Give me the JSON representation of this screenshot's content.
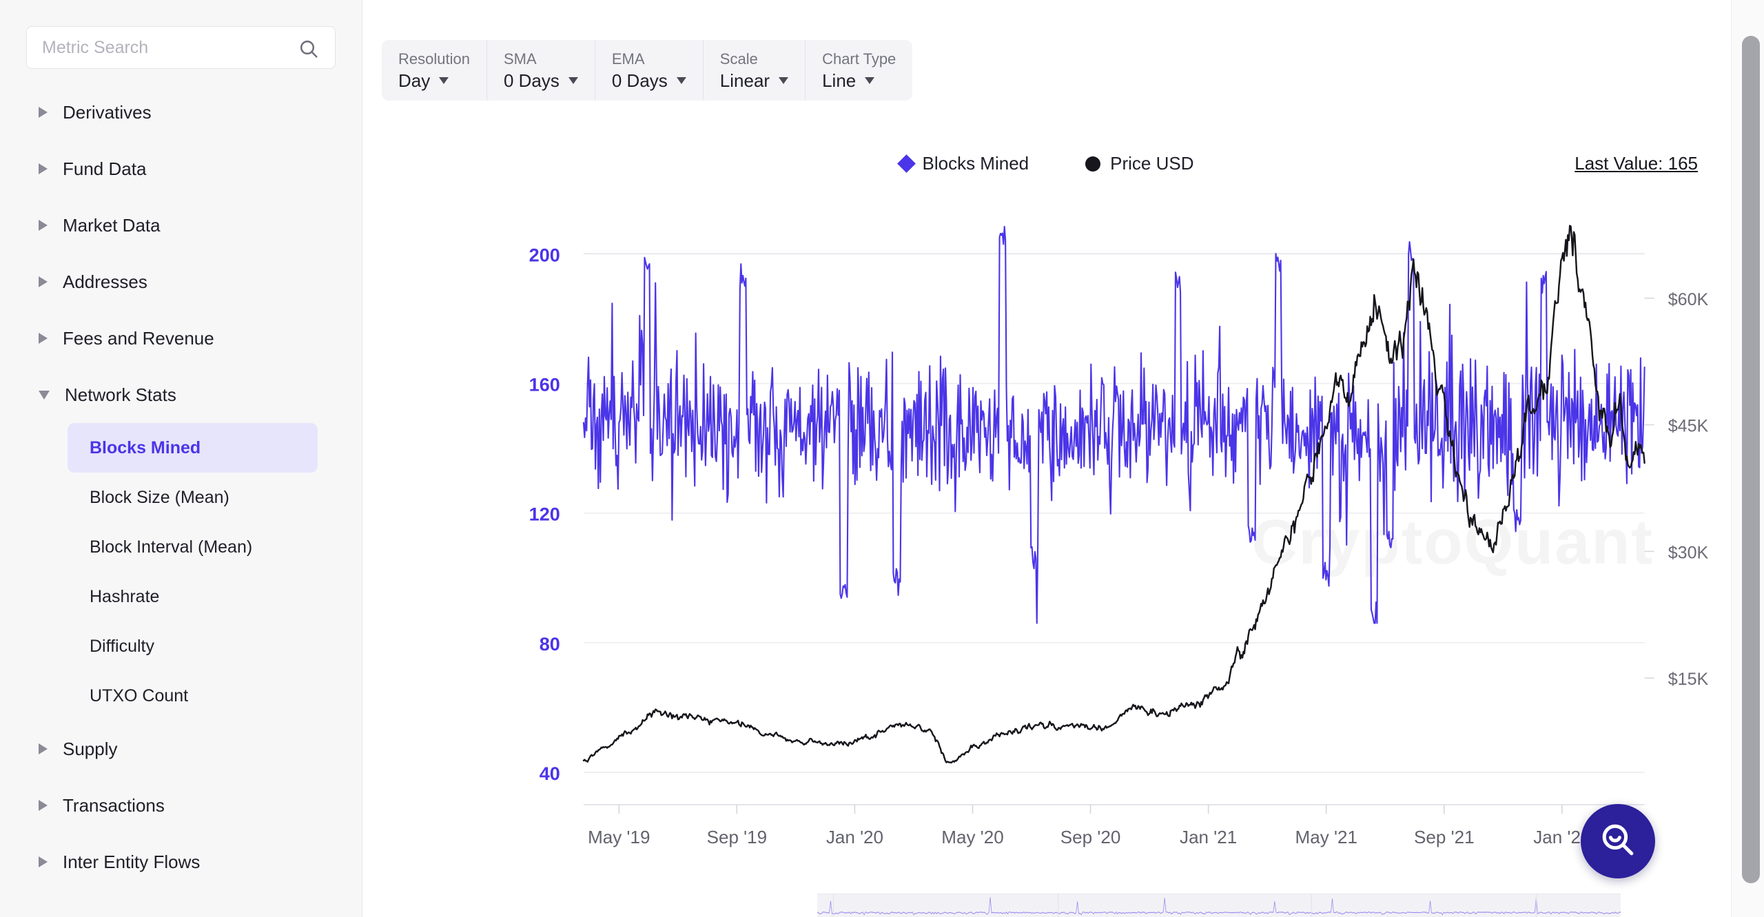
{
  "sidebar": {
    "search": {
      "placeholder": "Metric Search",
      "value": "",
      "icon": "search-icon"
    },
    "groups": [
      {
        "label": "Derivatives",
        "expanded": false
      },
      {
        "label": "Fund Data",
        "expanded": false
      },
      {
        "label": "Market Data",
        "expanded": false
      },
      {
        "label": "Addresses",
        "expanded": false
      },
      {
        "label": "Fees and Revenue",
        "expanded": false
      },
      {
        "label": "Network Stats",
        "expanded": true,
        "children": [
          {
            "label": "Blocks Mined",
            "active": true
          },
          {
            "label": "Block Size (Mean)",
            "active": false
          },
          {
            "label": "Block Interval (Mean)",
            "active": false
          },
          {
            "label": "Hashrate",
            "active": false
          },
          {
            "label": "Difficulty",
            "active": false
          },
          {
            "label": "UTXO Count",
            "active": false
          }
        ]
      },
      {
        "label": "Supply",
        "expanded": false
      },
      {
        "label": "Transactions",
        "expanded": false
      },
      {
        "label": "Inter Entity Flows",
        "expanded": false
      }
    ]
  },
  "toolbar": {
    "controls": [
      {
        "label": "Resolution",
        "value": "Day"
      },
      {
        "label": "SMA",
        "value": "0 Days"
      },
      {
        "label": "EMA",
        "value": "0 Days"
      },
      {
        "label": "Scale",
        "value": "Linear"
      },
      {
        "label": "Chart Type",
        "value": "Line"
      }
    ]
  },
  "chart_header": {
    "last_value_label": "Last Value: 165",
    "watermark": "CryptoQuant"
  },
  "fab": {
    "icon": "search-smile-icon"
  },
  "colors": {
    "accent_purple": "#4b35e8",
    "series_price": "#16161c",
    "sidebar_active_bg": "#e7e5fb",
    "fab_bg": "#2c209b",
    "grid": "#ececf0"
  },
  "chart_data": {
    "type": "line",
    "title": "",
    "xlabel": "",
    "grid": true,
    "legend_position": "top-center",
    "x_ticks": [
      "May '19",
      "Sep '19",
      "Jan '20",
      "May '20",
      "Sep '20",
      "Jan '21",
      "May '21",
      "Sep '21",
      "Jan '22"
    ],
    "x_range": [
      "2019-04-01",
      "2022-03-15"
    ],
    "axes": [
      {
        "id": "left",
        "name": "Blocks Mined",
        "ticks": [
          200,
          160,
          120,
          80,
          40
        ],
        "tick_labels": [
          "200",
          "160",
          "120",
          "80",
          "40"
        ],
        "ylim": [
          30,
          215
        ],
        "color": "#4b35e8"
      },
      {
        "id": "right",
        "name": "Price USD",
        "ticks": [
          60000,
          45000,
          30000,
          15000
        ],
        "tick_labels": [
          "$60K",
          "$45K",
          "$30K",
          "$15K"
        ],
        "ylim": [
          0,
          71000
        ],
        "color": "#6b6b76"
      }
    ],
    "series": [
      {
        "name": "Blocks Mined",
        "axis": "left",
        "color": "#4b35e8",
        "marker": "diamond",
        "style": "noisy-daily",
        "mean": 147,
        "noise_sd": 17,
        "min_seen": 88,
        "max_seen": 208,
        "last_value": 165,
        "anchors": [
          {
            "x": 0.0,
            "y": 148
          },
          {
            "x": 0.08,
            "y": 149
          },
          {
            "x": 0.16,
            "y": 147
          },
          {
            "x": 0.24,
            "y": 148
          },
          {
            "x": 0.32,
            "y": 146
          },
          {
            "x": 0.4,
            "y": 145
          },
          {
            "x": 0.48,
            "y": 147
          },
          {
            "x": 0.56,
            "y": 148
          },
          {
            "x": 0.64,
            "y": 147
          },
          {
            "x": 0.72,
            "y": 143
          },
          {
            "x": 0.8,
            "y": 146
          },
          {
            "x": 0.88,
            "y": 148
          },
          {
            "x": 1.0,
            "y": 150
          }
        ],
        "dips": [
          {
            "x": 0.245,
            "y": 95
          },
          {
            "x": 0.295,
            "y": 100
          },
          {
            "x": 0.425,
            "y": 108
          },
          {
            "x": 0.63,
            "y": 113
          },
          {
            "x": 0.7,
            "y": 103
          },
          {
            "x": 0.745,
            "y": 88
          },
          {
            "x": 0.76,
            "y": 112
          },
          {
            "x": 0.88,
            "y": 118
          }
        ],
        "spikes": [
          {
            "x": 0.06,
            "y": 196
          },
          {
            "x": 0.15,
            "y": 192
          },
          {
            "x": 0.395,
            "y": 205
          },
          {
            "x": 0.56,
            "y": 190
          },
          {
            "x": 0.655,
            "y": 197
          },
          {
            "x": 0.78,
            "y": 199
          },
          {
            "x": 0.905,
            "y": 192
          }
        ]
      },
      {
        "name": "Price USD",
        "axis": "right",
        "color": "#16161c",
        "marker": "circle",
        "style": "smooth-daily",
        "anchors": [
          {
            "x": 0.0,
            "y": 5300
          },
          {
            "x": 0.02,
            "y": 6800
          },
          {
            "x": 0.045,
            "y": 8600
          },
          {
            "x": 0.065,
            "y": 11000
          },
          {
            "x": 0.085,
            "y": 10600
          },
          {
            "x": 0.11,
            "y": 10200
          },
          {
            "x": 0.14,
            "y": 9800
          },
          {
            "x": 0.175,
            "y": 8300
          },
          {
            "x": 0.21,
            "y": 7400
          },
          {
            "x": 0.245,
            "y": 7200
          },
          {
            "x": 0.27,
            "y": 8100
          },
          {
            "x": 0.3,
            "y": 9400
          },
          {
            "x": 0.325,
            "y": 8700
          },
          {
            "x": 0.345,
            "y": 5100
          },
          {
            "x": 0.37,
            "y": 6900
          },
          {
            "x": 0.4,
            "y": 8700
          },
          {
            "x": 0.43,
            "y": 9500
          },
          {
            "x": 0.46,
            "y": 9200
          },
          {
            "x": 0.49,
            "y": 9100
          },
          {
            "x": 0.52,
            "y": 11500
          },
          {
            "x": 0.545,
            "y": 10600
          },
          {
            "x": 0.57,
            "y": 11700
          },
          {
            "x": 0.6,
            "y": 13500
          },
          {
            "x": 0.62,
            "y": 18500
          },
          {
            "x": 0.64,
            "y": 23000
          },
          {
            "x": 0.655,
            "y": 29000
          },
          {
            "x": 0.67,
            "y": 33000
          },
          {
            "x": 0.685,
            "y": 38000
          },
          {
            "x": 0.7,
            "y": 46000
          },
          {
            "x": 0.712,
            "y": 52000
          },
          {
            "x": 0.722,
            "y": 48000
          },
          {
            "x": 0.735,
            "y": 56000
          },
          {
            "x": 0.748,
            "y": 59000
          },
          {
            "x": 0.76,
            "y": 54000
          },
          {
            "x": 0.772,
            "y": 57000
          },
          {
            "x": 0.783,
            "y": 63000
          },
          {
            "x": 0.793,
            "y": 58000
          },
          {
            "x": 0.805,
            "y": 50000
          },
          {
            "x": 0.818,
            "y": 43000
          },
          {
            "x": 0.83,
            "y": 36000
          },
          {
            "x": 0.842,
            "y": 33000
          },
          {
            "x": 0.855,
            "y": 31000
          },
          {
            "x": 0.868,
            "y": 35000
          },
          {
            "x": 0.88,
            "y": 40000
          },
          {
            "x": 0.892,
            "y": 46000
          },
          {
            "x": 0.905,
            "y": 48000
          },
          {
            "x": 0.918,
            "y": 60000
          },
          {
            "x": 0.928,
            "y": 67000
          },
          {
            "x": 0.938,
            "y": 62000
          },
          {
            "x": 0.948,
            "y": 57000
          },
          {
            "x": 0.958,
            "y": 47000
          },
          {
            "x": 0.968,
            "y": 43000
          },
          {
            "x": 0.976,
            "y": 48000
          },
          {
            "x": 0.984,
            "y": 41000
          },
          {
            "x": 0.992,
            "y": 44000
          },
          {
            "x": 1.0,
            "y": 43000
          }
        ]
      }
    ]
  }
}
